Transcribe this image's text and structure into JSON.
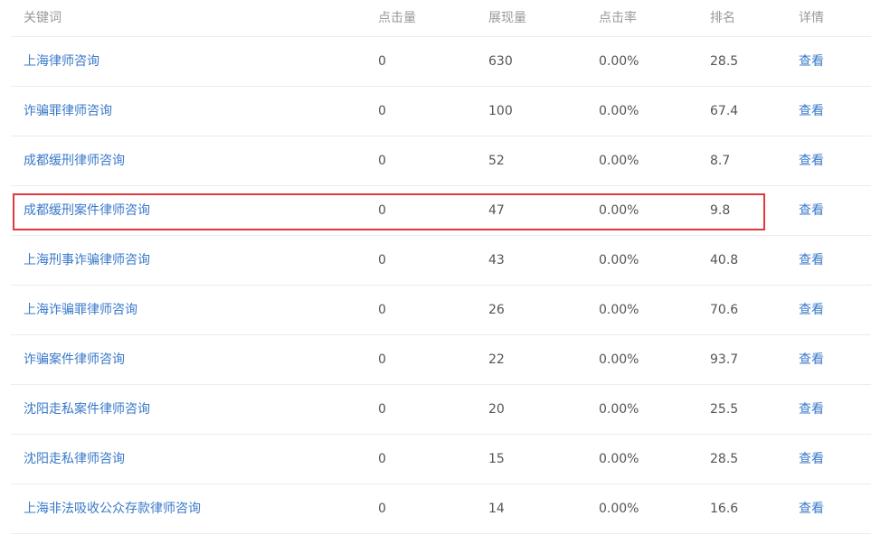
{
  "table": {
    "headers": {
      "keyword": "关键词",
      "clicks": "点击量",
      "impressions": "展现量",
      "ctr": "点击率",
      "rank": "排名",
      "detail": "详情"
    },
    "rows": [
      {
        "keyword": "上海律师咨询",
        "clicks": "0",
        "impressions": "630",
        "ctr": "0.00%",
        "rank": "28.5",
        "detail": "查看"
      },
      {
        "keyword": "诈骗罪律师咨询",
        "clicks": "0",
        "impressions": "100",
        "ctr": "0.00%",
        "rank": "67.4",
        "detail": "查看"
      },
      {
        "keyword": "成都缓刑律师咨询",
        "clicks": "0",
        "impressions": "52",
        "ctr": "0.00%",
        "rank": "8.7",
        "detail": "查看"
      },
      {
        "keyword": "成都缓刑案件律师咨询",
        "clicks": "0",
        "impressions": "47",
        "ctr": "0.00%",
        "rank": "9.8",
        "detail": "查看"
      },
      {
        "keyword": "上海刑事诈骗律师咨询",
        "clicks": "0",
        "impressions": "43",
        "ctr": "0.00%",
        "rank": "40.8",
        "detail": "查看"
      },
      {
        "keyword": "上海诈骗罪律师咨询",
        "clicks": "0",
        "impressions": "26",
        "ctr": "0.00%",
        "rank": "70.6",
        "detail": "查看"
      },
      {
        "keyword": "诈骗案件律师咨询",
        "clicks": "0",
        "impressions": "22",
        "ctr": "0.00%",
        "rank": "93.7",
        "detail": "查看"
      },
      {
        "keyword": "沈阳走私案件律师咨询",
        "clicks": "0",
        "impressions": "20",
        "ctr": "0.00%",
        "rank": "25.5",
        "detail": "查看"
      },
      {
        "keyword": "沈阳走私律师咨询",
        "clicks": "0",
        "impressions": "15",
        "ctr": "0.00%",
        "rank": "28.5",
        "detail": "查看"
      },
      {
        "keyword": "上海非法吸收公众存款律师咨询",
        "clicks": "0",
        "impressions": "14",
        "ctr": "0.00%",
        "rank": "16.6",
        "detail": "查看"
      }
    ]
  },
  "colors": {
    "link": "#3a79c9",
    "highlight_border": "#e0383e",
    "header_text": "#999999",
    "body_text": "#555555",
    "row_divider": "#ececec"
  }
}
